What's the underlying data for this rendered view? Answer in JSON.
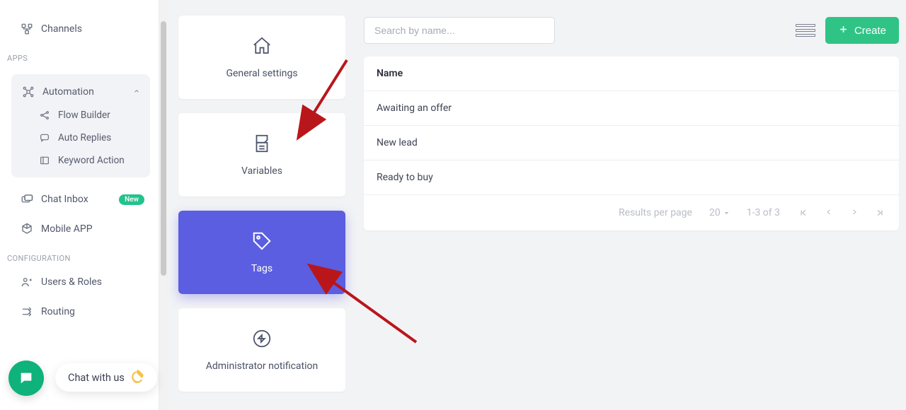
{
  "sidebar": {
    "channels": "Channels",
    "apps_label": "APPS",
    "automation": "Automation",
    "flow_builder": "Flow Builder",
    "auto_replies": "Auto Replies",
    "keyword_action": "Keyword Action",
    "chat_inbox": "Chat Inbox",
    "new_badge": "New",
    "mobile_app": "Mobile APP",
    "config_label": "CONFIGURATION",
    "users_roles": "Users & Roles",
    "routing": "Routing"
  },
  "chat": {
    "label": "Chat with us"
  },
  "cards": {
    "general": "General settings",
    "variables": "Variables",
    "tags": "Tags",
    "admin": "Administrator notification"
  },
  "toolbar": {
    "search_placeholder": "Search by name...",
    "create_label": "Create"
  },
  "table": {
    "header": "Name",
    "rows": [
      "Awaiting an offer",
      "New lead",
      "Ready to buy"
    ]
  },
  "footer": {
    "rpp_label": "Results per page",
    "rpp_value": "20",
    "range": "1-3 of 3"
  }
}
